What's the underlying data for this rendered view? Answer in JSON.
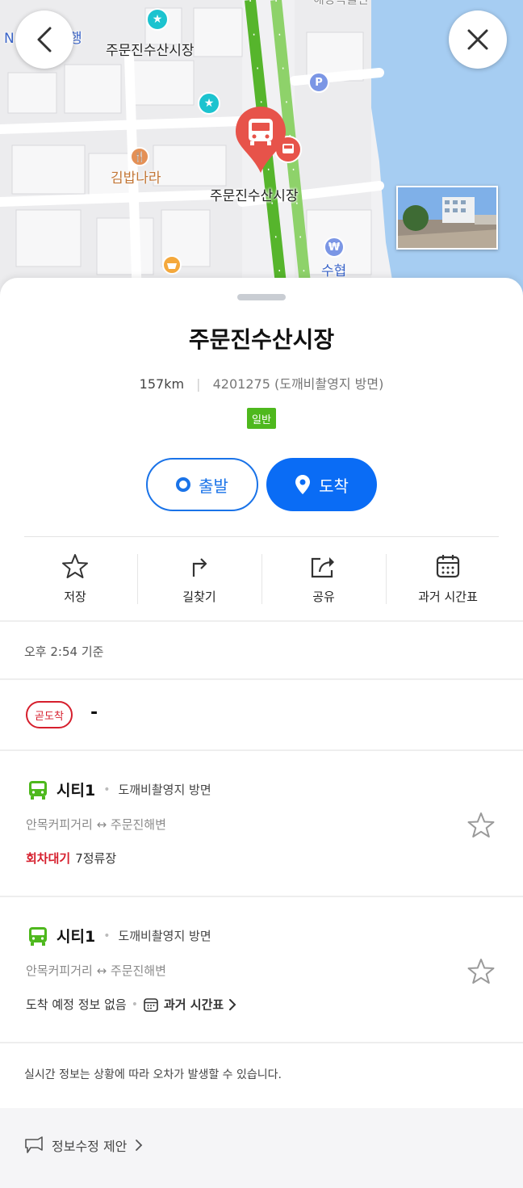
{
  "map": {
    "labels": {
      "market_top": "주문진수산시장",
      "market_bottom": "주문진수산시장",
      "restaurant": "김밥나라",
      "bank": "수협",
      "partial_left": "N",
      "partial_left2": "행",
      "partial_top": "해양곡물관"
    },
    "poi_icons": [
      "star-icon",
      "star-icon",
      "fork-knife-icon",
      "parking-icon",
      "won-icon",
      "basket-icon"
    ],
    "route_color": "#6abf3a"
  },
  "controls": {
    "back_icon": "chevron-left-icon",
    "close_icon": "close-icon"
  },
  "stop": {
    "name": "주문진수산시장",
    "distance": "157km",
    "stop_id": "4201275",
    "direction": "(도깨비촬영지 방면)",
    "type_badge": "일반",
    "depart_label": "출발",
    "arrive_label": "도착"
  },
  "actions": [
    {
      "icon": "star-outline-icon",
      "label": "저장"
    },
    {
      "icon": "turn-right-icon",
      "label": "길찾기"
    },
    {
      "icon": "share-icon",
      "label": "공유"
    },
    {
      "icon": "calendar-icon",
      "label": "과거 시간표"
    }
  ],
  "timebase": "오후 2:54 기준",
  "soon": {
    "badge": "곧도착",
    "value": "-"
  },
  "routes": [
    {
      "name": "시티1",
      "direction": "도깨비촬영지 방면",
      "path": "안목커피거리 ↔ 주문진해변",
      "status_highlight": "회차대기",
      "status_text": "7정류장"
    },
    {
      "name": "시티1",
      "direction": "도깨비촬영지 방면",
      "path": "안목커피거리 ↔ 주문진해변",
      "status_text": "도착 예정 정보 없음",
      "timetable_link": "과거 시간표"
    }
  ],
  "notice": "실시간 정보는 상황에 따라 오차가 발생할 수 있습니다.",
  "footer": {
    "suggest_label": "정보수정 제안"
  },
  "colors": {
    "accent_blue": "#0a6cf5",
    "bus_green": "#4eb81d",
    "alert_red": "#d61f2d",
    "marker_red": "#e7534a"
  }
}
